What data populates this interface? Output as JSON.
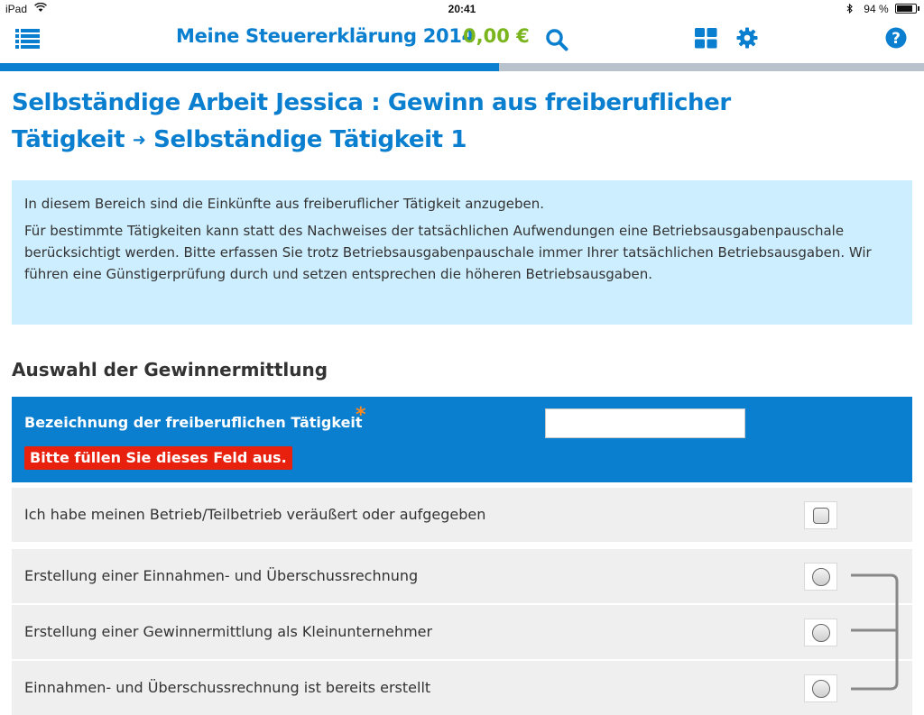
{
  "status_bar": {
    "device": "iPad",
    "time": "20:41",
    "battery": "94 %",
    "battery_level": 0.94
  },
  "app_bar": {
    "title": "Meine Steuererklärung 2014",
    "amount": "0,00 €",
    "icons": [
      "list-icon",
      "search-icon",
      "grid-icon",
      "gear-icon",
      "help-icon"
    ],
    "progress": 0.54
  },
  "page": {
    "title_part1": "Selbständige Arbeit Jessica : Gewinn aus freiberuflicher Tätigkeit",
    "arrow": "➜",
    "title_part2": "Selbständige Tätigkeit 1"
  },
  "info": {
    "line1": "In diesem Bereich sind die Einkünfte aus freiberuflicher Tätigkeit anzugeben.",
    "line2": "Für bestimmte Tätigkeiten kann statt des Nachweises der tatsächlichen Aufwendungen eine Betriebsausgabenpauschale berücksichtigt werden. Bitte erfassen Sie trotz Betriebsausgabenpauschale immer Ihrer tatsächlichen Betriebsausgaben. Wir führen eine Günstigerprüfung durch und setzen entsprechen die höheren Betriebsausgaben."
  },
  "section": {
    "title": "Auswahl der Gewinnermittlung",
    "field": {
      "label": "Bezeichnung der freiberuflichen Tätigkeit",
      "required_mark": "*",
      "value": "",
      "error": "Bitte füllen Sie dieses Feld aus."
    },
    "checkbox_label": "Ich habe meinen Betrieb/Teilbetrieb veräußert oder aufgegeben",
    "options": [
      "Erstellung einer Einnahmen- und Überschussrechnung",
      "Erstellung einer Gewinnermittlung als Kleinunternehmer",
      "Einnahmen- und Überschussrechnung ist bereits erstellt"
    ]
  },
  "colors": {
    "accent": "#0a7ecf",
    "amount": "#7ab51d",
    "error": "#e8200e",
    "info_bg": "#cdeeff",
    "required": "#ff8a1e"
  }
}
